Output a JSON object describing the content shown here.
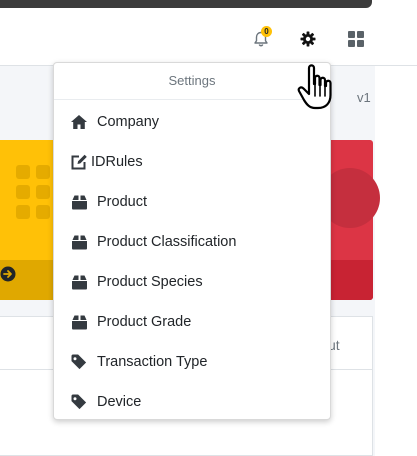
{
  "navbar": {
    "notifications": {
      "icon": "bell-icon",
      "badge_count": "0",
      "badge_color": "#ffc107"
    },
    "settings": {
      "icon": "gear-icon"
    },
    "apps": {
      "icon": "apps-grid-icon"
    }
  },
  "background": {
    "version_text": "v1",
    "table_header_fragment": "ut",
    "card_colors": {
      "yellow": "#ffc107",
      "red": "#dc3545"
    }
  },
  "settings_menu": {
    "header": "Settings",
    "items": [
      {
        "label": "Company",
        "icon": "home-icon"
      },
      {
        "label": "IDRules",
        "icon": "edit-icon"
      },
      {
        "label": "Product",
        "icon": "box-icon"
      },
      {
        "label": "Product Classification",
        "icon": "box-icon"
      },
      {
        "label": "Product Species",
        "icon": "box-icon"
      },
      {
        "label": "Product Grade",
        "icon": "box-icon"
      },
      {
        "label": "Transaction Type",
        "icon": "tag-icon"
      },
      {
        "label": "Device",
        "icon": "tag-icon"
      }
    ]
  },
  "cursor": {
    "icon": "hand-pointer-icon"
  }
}
